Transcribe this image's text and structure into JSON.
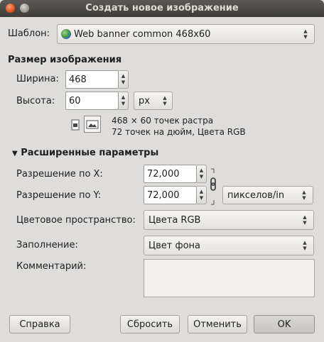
{
  "window": {
    "title": "Создать новое изображение"
  },
  "template": {
    "label": "Шаблон:",
    "value": "Web banner common 468x60"
  },
  "image_size": {
    "heading": "Размер изображения",
    "width_label": "Ширина:",
    "width_value": "468",
    "height_label": "Высота:",
    "height_value": "60",
    "unit": "px",
    "info_line1": "468 × 60 точек растра",
    "info_line2": "72 точек на дюйм, Цвета RGB"
  },
  "advanced": {
    "heading": "Расширенные параметры",
    "xres_label": "Разрешение по X:",
    "xres_value": "72,000",
    "yres_label": "Разрешение по Y:",
    "yres_value": "72,000",
    "res_unit": "пикселов/in",
    "colorspace_label": "Цветовое пространство:",
    "colorspace_value": "Цвета RGB",
    "fill_label": "Заполнение:",
    "fill_value": "Цвет фона",
    "comment_label": "Комментарий:",
    "comment_value": ""
  },
  "buttons": {
    "help": "Справка",
    "reset": "Сбросить",
    "cancel": "Отменить",
    "ok": "OK"
  }
}
